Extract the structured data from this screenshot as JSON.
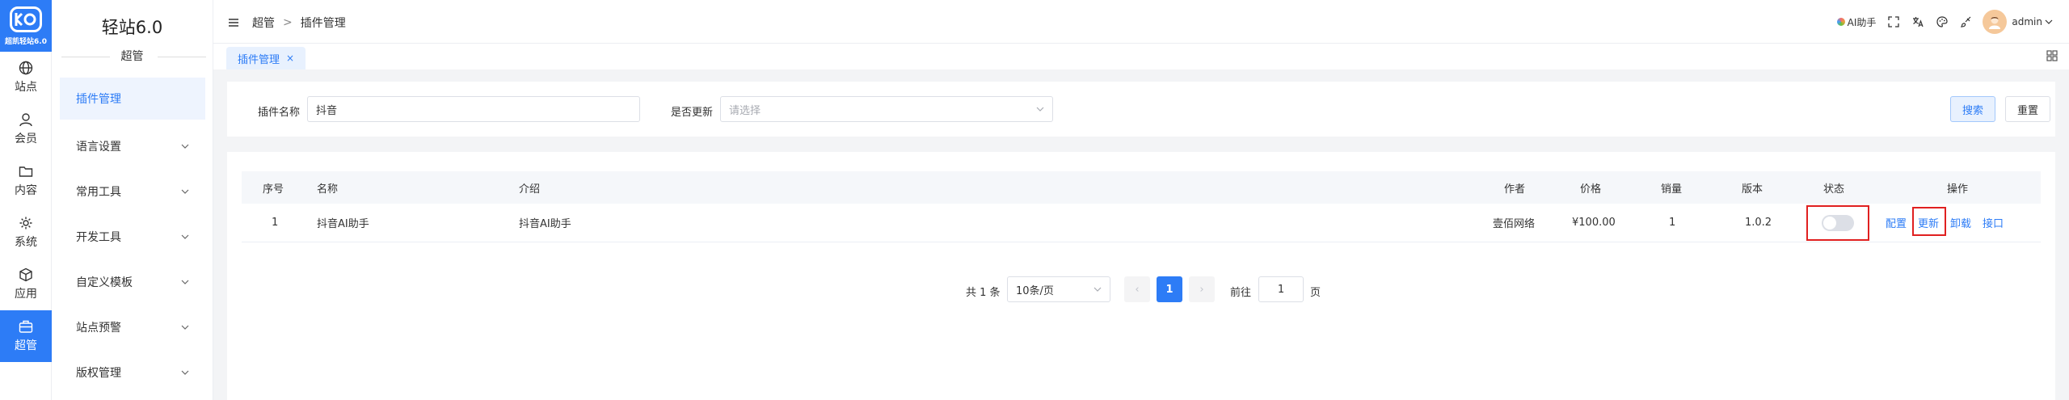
{
  "rail": {
    "brand": "超凯轻站6.0",
    "items": [
      {
        "label": "站点",
        "icon": "globe-icon"
      },
      {
        "label": "会员",
        "icon": "user-icon"
      },
      {
        "label": "内容",
        "icon": "folder-icon"
      },
      {
        "label": "系统",
        "icon": "settings-icon"
      },
      {
        "label": "应用",
        "icon": "cube-icon"
      },
      {
        "label": "超管",
        "icon": "briefcase-icon",
        "active": true
      }
    ]
  },
  "sidebar": {
    "title": "轻站6.0",
    "subtitle": "超管",
    "items": [
      {
        "label": "插件管理",
        "active": true
      },
      {
        "label": "语言设置"
      },
      {
        "label": "常用工具"
      },
      {
        "label": "开发工具"
      },
      {
        "label": "自定义模板"
      },
      {
        "label": "站点预警"
      },
      {
        "label": "版权管理"
      }
    ]
  },
  "header": {
    "breadcrumb": [
      "超管",
      ">",
      "插件管理"
    ],
    "ai_label": "AI助手",
    "user": "admin"
  },
  "tabs": [
    {
      "label": "插件管理",
      "close": "×"
    }
  ],
  "search": {
    "name_label": "插件名称",
    "name_value": "抖音",
    "update_label": "是否更新",
    "update_placeholder": "请选择",
    "search_button": "搜索",
    "reset_button": "重置"
  },
  "table": {
    "headers": [
      "序号",
      "名称",
      "介绍",
      "作者",
      "价格",
      "销量",
      "版本",
      "状态",
      "操作"
    ],
    "rows": [
      {
        "index": "1",
        "name": "抖音AI助手",
        "intro": "抖音AI助手",
        "author": "壹佰网络",
        "price": "¥100.00",
        "sales": "1",
        "version": "1.0.2",
        "enabled": false,
        "actions": [
          "配置",
          "更新",
          "卸载",
          "接口"
        ]
      }
    ]
  },
  "pagination": {
    "total": "共 1 条",
    "page_size": "10条/页",
    "prev": "‹",
    "current": "1",
    "next": "›",
    "goto_label": "前往",
    "goto_value": "1",
    "page_unit": "页"
  },
  "colors": {
    "primary": "#2d7cf6",
    "highlight": "#e02020"
  }
}
